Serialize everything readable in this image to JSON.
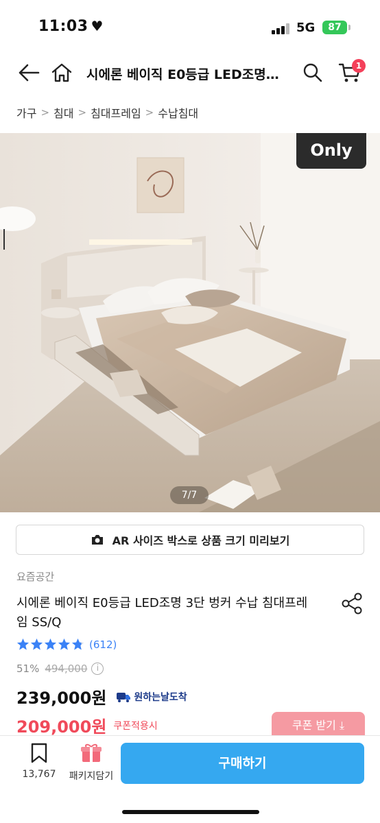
{
  "status_bar": {
    "time": "11:03",
    "network": "5G",
    "battery": "87"
  },
  "header": {
    "title": "시에론 베이직 E0등급 LED조명…",
    "cart_count": "1"
  },
  "breadcrumb": [
    "가구",
    "침대",
    "침대프레임",
    "수납침대"
  ],
  "hero": {
    "badge": "Only",
    "page_counter": "7/7"
  },
  "ar_button": {
    "label": "AR 사이즈 박스로 상품 크기 미리보기"
  },
  "product": {
    "brand": "요즘공간",
    "title": "시에론 베이직 E0등급 LED조명 3단 벙커 수납 침대프레임 SS/Q",
    "rating": 4.8,
    "review_count": "(612)",
    "discount": "51%",
    "original_price": "494,000",
    "price": "239,000원",
    "delivery_badge": "원하는날도착",
    "coupon_price": "209,000원",
    "coupon_note": "쿠폰적용시",
    "coupon_button": "쿠폰 받기"
  },
  "bottom_bar": {
    "wish_count": "13,767",
    "package_label": "패키지담기",
    "buy_label": "구매하기"
  },
  "colors": {
    "accent": "#35a8f0",
    "sale": "#f04a5a",
    "badge": "#f4405a",
    "star": "#3b82f6"
  }
}
